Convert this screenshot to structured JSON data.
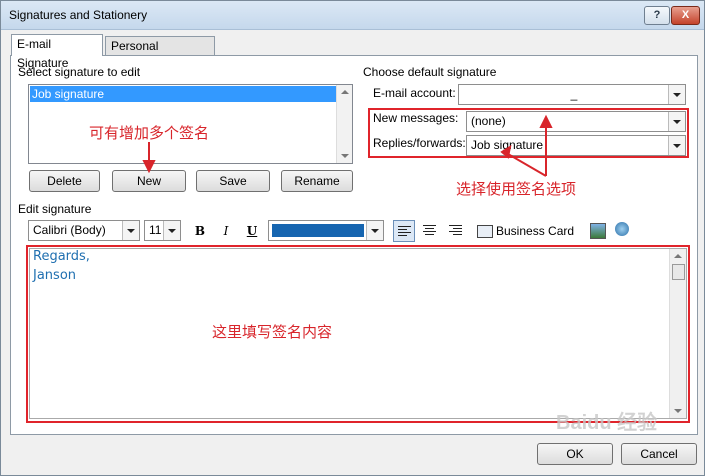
{
  "window": {
    "title": "Signatures and Stationery",
    "help_label": "?",
    "close_label": "X"
  },
  "tabs": [
    {
      "label": "E-mail Signature",
      "active": true
    },
    {
      "label": "Personal Stationery",
      "active": false
    }
  ],
  "select_section": {
    "label": "Select signature to edit",
    "items": [
      "Job signature"
    ],
    "selected": "Job signature"
  },
  "signature_buttons": {
    "delete": "Delete",
    "new": "New",
    "save": "Save",
    "rename": "Rename"
  },
  "default_section": {
    "label": "Choose default signature",
    "email_account_label": "E-mail account:",
    "email_account_value": "_",
    "new_messages_label": "New messages:",
    "new_messages_value": "(none)",
    "replies_label": "Replies/forwards:",
    "replies_value": "Job signature"
  },
  "edit_section": {
    "label": "Edit signature",
    "font": "Calibri (Body)",
    "size": "11",
    "bold": "B",
    "italic": "I",
    "underline": "U",
    "font_color": "#1665b0",
    "business_card": "Business Card",
    "content_lines": [
      "Regards,",
      "Janson"
    ],
    "text_color": "#1f6fb0"
  },
  "annotations": {
    "multiple": "可有增加多个签名",
    "choose": "选择使用签名选项",
    "fill": "这里填写签名内容",
    "color": "#d8252b"
  },
  "footer": {
    "ok": "OK",
    "cancel": "Cancel"
  },
  "watermark": "Baidu 经验"
}
